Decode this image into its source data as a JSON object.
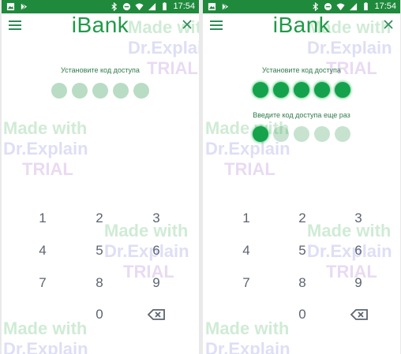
{
  "status_bar": {
    "time": "17:54",
    "icons": [
      "image-icon",
      "play-store-icon",
      "bluetooth-icon",
      "do-not-disturb-icon",
      "wifi-icon",
      "signal-icon",
      "battery-icon"
    ]
  },
  "app": {
    "title": "iBank",
    "menu_icon": "hamburger-menu-icon",
    "close_icon": "close-icon"
  },
  "screens": {
    "left": {
      "prompt": "Установите код доступа",
      "code_length": 5,
      "filled": 0
    },
    "right": {
      "prompt": "Установите код доступа",
      "code_length": 5,
      "filled": 5,
      "confirm_prompt": "Введите код доступа еще раз",
      "confirm_filled": 1
    }
  },
  "keypad": {
    "keys": [
      "1",
      "2",
      "3",
      "4",
      "5",
      "6",
      "7",
      "8",
      "9",
      "0"
    ],
    "backspace_icon": "backspace-icon"
  },
  "watermark": {
    "line1": "Made with",
    "line2": "Dr.Explain",
    "line3": "TRIAL"
  },
  "colors": {
    "status_bar": "#1f8a3c",
    "accent": "#1f9a47",
    "dot_filled": "#15a24c",
    "dot_empty": "#b9dcc4"
  }
}
